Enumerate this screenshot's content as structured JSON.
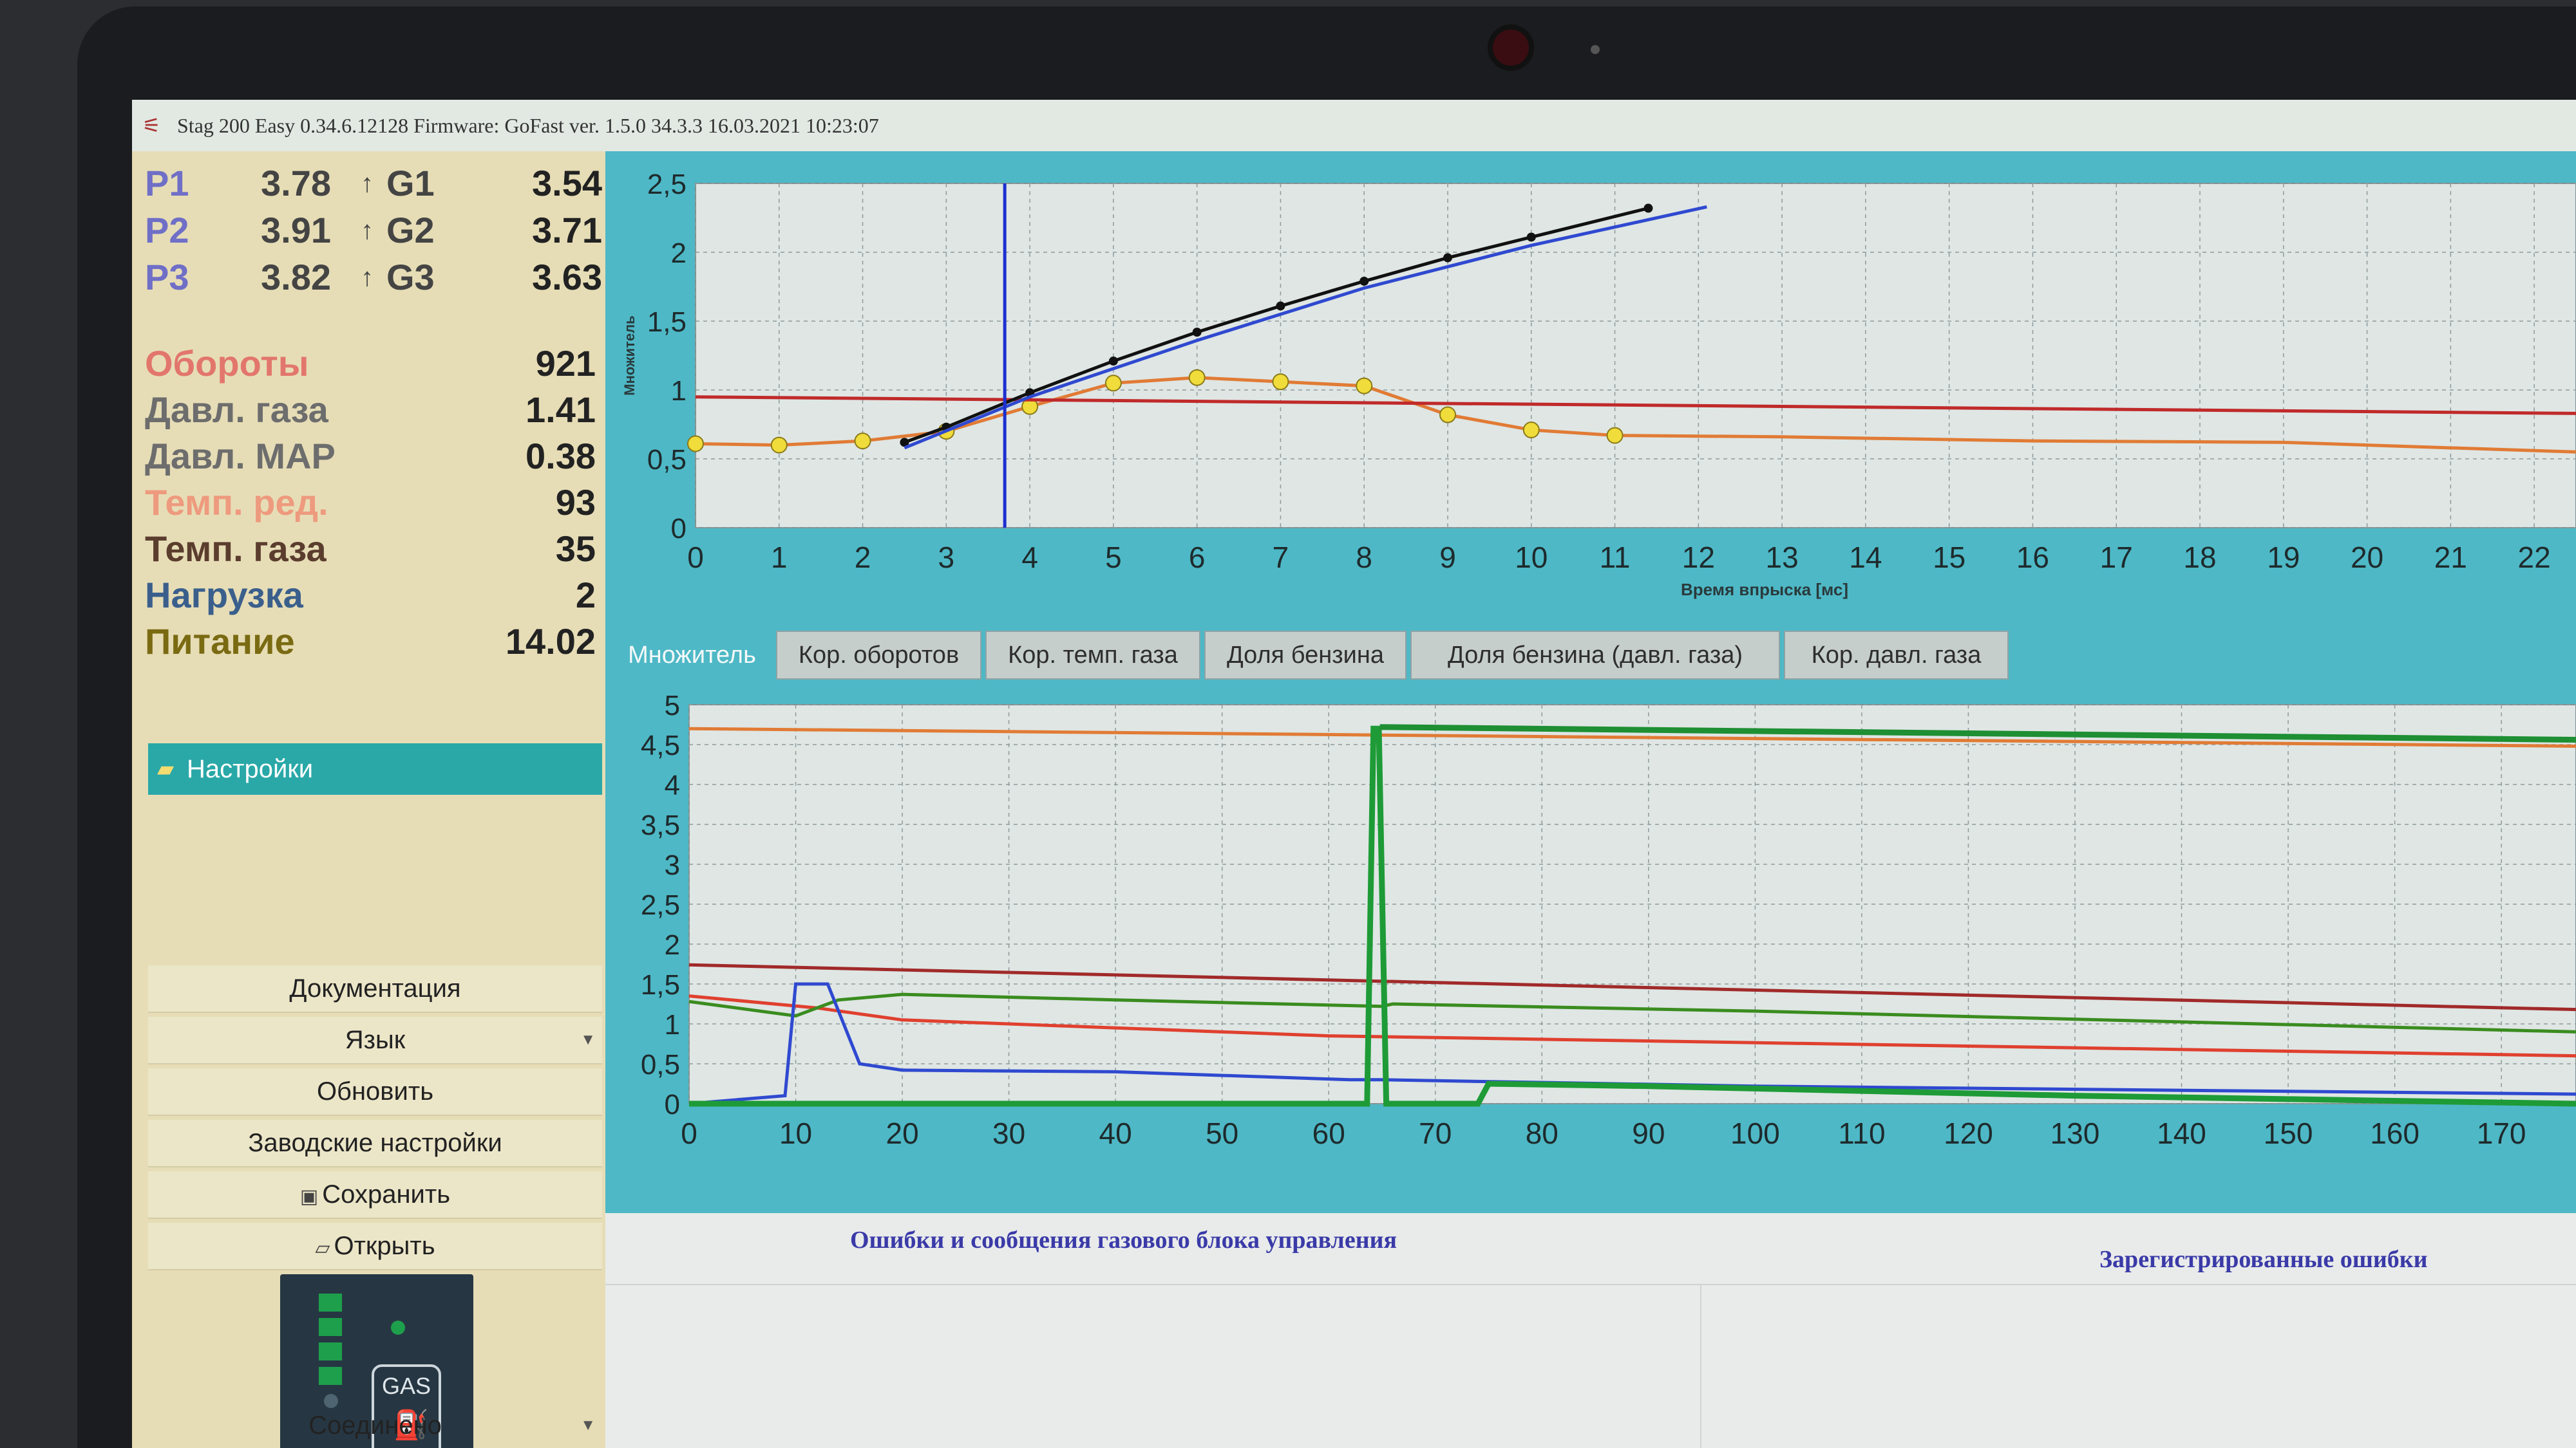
{
  "window": {
    "title": "Stag 200 Easy 0.34.6.12128 Firmware: GoFast  ver. 1.5.0  34.3.3   16.03.2021 10:23:07"
  },
  "readings": {
    "p1": {
      "label": "P1",
      "value": "3.78",
      "g_label": "G1",
      "g_value": "3.54"
    },
    "p2": {
      "label": "P2",
      "value": "3.91",
      "g_label": "G2",
      "g_value": "3.71"
    },
    "p3": {
      "label": "P3",
      "value": "3.82",
      "g_label": "G3",
      "g_value": "3.63"
    },
    "params": [
      {
        "label": "Обороты",
        "value": "921",
        "color": "#e2766d"
      },
      {
        "label": "Давл. газа",
        "value": "1.41",
        "color": "#6d6d6d"
      },
      {
        "label": "Давл. MAP",
        "value": "0.38",
        "color": "#6d6d6d"
      },
      {
        "label": "Темп. ред.",
        "value": "93",
        "color": "#ee9a7e"
      },
      {
        "label": "Темп. газа",
        "value": "35",
        "color": "#5b3d2e"
      },
      {
        "label": "Нагрузка",
        "value": "2",
        "color": "#3a5f8c"
      },
      {
        "label": "Питание",
        "value": "14.02",
        "color": "#7a6a12"
      }
    ]
  },
  "sidebar": {
    "settings_label": "Настройки",
    "items": [
      {
        "label": "Документация"
      },
      {
        "label": "Язык"
      },
      {
        "label": "Обновить"
      },
      {
        "label": "Заводские настройки"
      },
      {
        "label": "Сохранить"
      },
      {
        "label": "Открыть"
      }
    ],
    "gas_label": "GAS",
    "status": "Соединено"
  },
  "tabs": [
    {
      "label": "Множитель",
      "active": true
    },
    {
      "label": "Кор. оборотов",
      "active": false
    },
    {
      "label": "Кор. темп. газа",
      "active": false
    },
    {
      "label": "Доля бензина",
      "active": false
    },
    {
      "label": "Доля бензина (давл. газа)",
      "active": false
    },
    {
      "label": "Кор. давл. газа",
      "active": false
    }
  ],
  "chart_data": [
    {
      "type": "line",
      "ylabel": "Множитель",
      "xlabel": "Время впрыска [мс]",
      "xlim": [
        0,
        22.5
      ],
      "ylim": [
        0,
        2.5
      ],
      "x_ticks": [
        "0",
        "1",
        "2",
        "3",
        "4",
        "5",
        "6",
        "7",
        "8",
        "9",
        "10",
        "11",
        "12",
        "13",
        "14",
        "15",
        "16",
        "17",
        "18",
        "19",
        "20",
        "21",
        "22"
      ],
      "y_ticks": [
        "0",
        "0,5",
        "1",
        "1,5",
        "2",
        "2,5"
      ],
      "grid": true,
      "cursor_x": 3.7,
      "series": [
        {
          "color": "#e17b35",
          "x": [
            0,
            1,
            2,
            3,
            4,
            5,
            6,
            7,
            8,
            9,
            10,
            11,
            13,
            16,
            19,
            22.5
          ],
          "y": [
            0.61,
            0.6,
            0.63,
            0.7,
            0.88,
            1.05,
            1.09,
            1.06,
            1.03,
            0.82,
            0.71,
            0.67,
            0.66,
            0.63,
            0.62,
            0.55
          ]
        },
        {
          "color": "#c02a2a",
          "x": [
            0,
            22.5
          ],
          "y": [
            0.95,
            0.83
          ]
        },
        {
          "color": "#111111",
          "x": [
            2.5,
            3,
            4,
            5,
            6,
            7,
            8,
            9,
            10,
            11.4
          ],
          "y": [
            0.62,
            0.73,
            0.98,
            1.21,
            1.42,
            1.61,
            1.79,
            1.96,
            2.11,
            2.32
          ]
        },
        {
          "color": "#2f49d0",
          "x": [
            2.5,
            4,
            6,
            8,
            10,
            12.1
          ],
          "y": [
            0.58,
            0.95,
            1.36,
            1.74,
            2.05,
            2.33
          ]
        }
      ]
    },
    {
      "type": "line",
      "xlim": [
        0,
        177
      ],
      "ylim": [
        0,
        5
      ],
      "x_ticks": [
        "0",
        "10",
        "20",
        "30",
        "40",
        "50",
        "60",
        "70",
        "80",
        "90",
        "100",
        "110",
        "120",
        "130",
        "140",
        "150",
        "160",
        "170"
      ],
      "y_ticks": [
        "0",
        "0,5",
        "1",
        "1,5",
        "2",
        "2,5",
        "3",
        "3,5",
        "4",
        "4,5",
        "5"
      ],
      "grid": true,
      "series": [
        {
          "color": "#e17b35",
          "x": [
            0,
            177
          ],
          "y": [
            4.7,
            4.48
          ]
        },
        {
          "color": "#a12a2a",
          "x": [
            0,
            177
          ],
          "y": [
            1.74,
            1.18
          ]
        },
        {
          "color": "#e0402f",
          "x": [
            0,
            12,
            20,
            60,
            177
          ],
          "y": [
            1.35,
            1.2,
            1.05,
            0.85,
            0.6
          ]
        },
        {
          "color": "#3a8c1f",
          "x": [
            0,
            10,
            14,
            20,
            40,
            65,
            66,
            100,
            177
          ],
          "y": [
            1.28,
            1.1,
            1.3,
            1.37,
            1.3,
            1.22,
            1.25,
            1.16,
            0.9
          ]
        },
        {
          "color": "#2f49d0",
          "x": [
            0,
            9,
            10,
            13,
            16,
            20,
            40,
            62,
            65,
            100,
            177
          ],
          "y": [
            0,
            0.1,
            1.5,
            1.5,
            0.5,
            0.42,
            0.4,
            0.3,
            0.3,
            0.22,
            0.12
          ]
        },
        {
          "color": "#1e9b37",
          "x": [
            0,
            63.6,
            64.2,
            64.7,
            65.4,
            66,
            74,
            75,
            90,
            130,
            177
          ],
          "y": [
            0,
            0,
            4.7,
            4.7,
            0,
            0,
            0,
            0.25,
            0.22,
            0.1,
            0
          ]
        },
        {
          "color": "#1e8f33",
          "x": [
            64.8,
            177
          ],
          "y": [
            4.72,
            4.56
          ]
        }
      ]
    }
  ],
  "messages": {
    "errors_title": "Ошибки и сообщения газового блока управления",
    "registered_title": "Зарегистрированные ошибки"
  }
}
